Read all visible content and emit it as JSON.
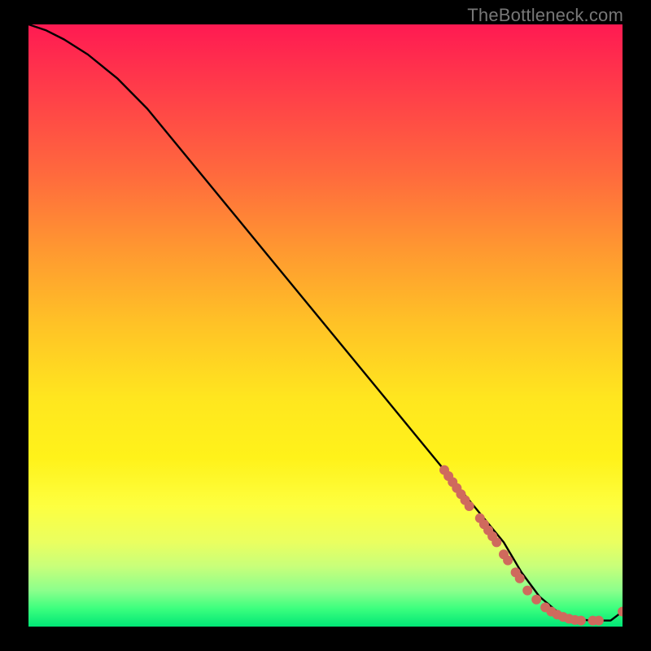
{
  "watermark": "TheBottleneck.com",
  "colors": {
    "background": "#000000",
    "line": "#000000",
    "marker": "#cf6a5d",
    "gradient_top": "#ff1a52",
    "gradient_mid": "#ffe61f",
    "gradient_bottom": "#00e676"
  },
  "chart_data": {
    "type": "line",
    "title": "",
    "xlabel": "",
    "ylabel": "",
    "xlim": [
      0,
      100
    ],
    "ylim": [
      0,
      100
    ],
    "grid": false,
    "series": [
      {
        "name": "curve",
        "x": [
          0,
          3,
          6,
          10,
          15,
          20,
          25,
          30,
          35,
          40,
          45,
          50,
          55,
          60,
          65,
          70,
          75,
          80,
          83,
          86,
          89,
          92,
          95,
          98,
          100
        ],
        "y": [
          100,
          99,
          97.5,
          95,
          91,
          86,
          80,
          74,
          68,
          62,
          56,
          50,
          44,
          38,
          32,
          26,
          20,
          14,
          9,
          5,
          2.5,
          1.2,
          1.0,
          1.0,
          2.5
        ]
      }
    ],
    "markers": [
      {
        "x": 70.0,
        "y": 26.0
      },
      {
        "x": 70.7,
        "y": 25.0
      },
      {
        "x": 71.4,
        "y": 24.0
      },
      {
        "x": 72.1,
        "y": 23.0
      },
      {
        "x": 72.8,
        "y": 22.0
      },
      {
        "x": 73.5,
        "y": 21.0
      },
      {
        "x": 74.2,
        "y": 20.0
      },
      {
        "x": 76.0,
        "y": 18.0
      },
      {
        "x": 76.7,
        "y": 17.0
      },
      {
        "x": 77.4,
        "y": 16.0
      },
      {
        "x": 78.1,
        "y": 15.0
      },
      {
        "x": 78.8,
        "y": 14.0
      },
      {
        "x": 80.0,
        "y": 12.0
      },
      {
        "x": 80.7,
        "y": 11.0
      },
      {
        "x": 82.0,
        "y": 9.0
      },
      {
        "x": 82.7,
        "y": 8.0
      },
      {
        "x": 84.0,
        "y": 6.0
      },
      {
        "x": 85.5,
        "y": 4.5
      },
      {
        "x": 87.0,
        "y": 3.2
      },
      {
        "x": 88.0,
        "y": 2.5
      },
      {
        "x": 89.0,
        "y": 2.0
      },
      {
        "x": 90.0,
        "y": 1.6
      },
      {
        "x": 91.0,
        "y": 1.3
      },
      {
        "x": 92.0,
        "y": 1.1
      },
      {
        "x": 93.0,
        "y": 1.0
      },
      {
        "x": 95.0,
        "y": 1.0
      },
      {
        "x": 96.0,
        "y": 1.0
      },
      {
        "x": 100.0,
        "y": 2.5
      }
    ]
  }
}
